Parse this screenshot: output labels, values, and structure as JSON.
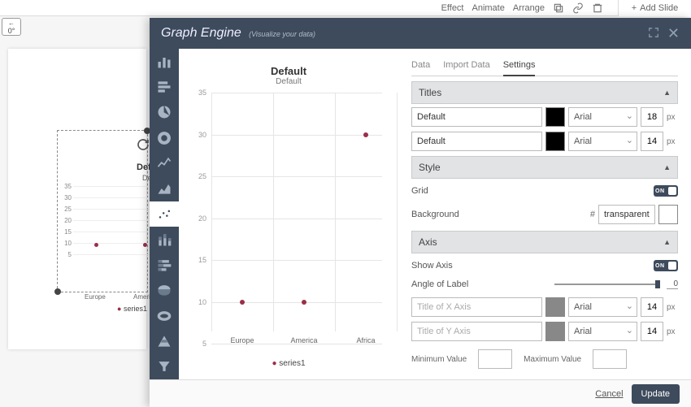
{
  "toolbar": {
    "effect": "Effect",
    "animate": "Animate",
    "arrange": "Arrange",
    "add_slide": "Add Slide",
    "zero": "0°"
  },
  "bg_chart": {
    "title": "Default",
    "subtitle": "Default",
    "legend": "series1",
    "xlabels": [
      "Europe",
      "America"
    ]
  },
  "modal": {
    "title": "Graph Engine",
    "subtitle": "(Visualize your data)"
  },
  "chart_data": {
    "type": "scatter",
    "title": "Default",
    "subtitle": "Default",
    "categories": [
      "Europe",
      "America",
      "Africa"
    ],
    "series": [
      {
        "name": "series1",
        "values": [
          10,
          10,
          30
        ]
      }
    ],
    "yticks": [
      5,
      10,
      15,
      20,
      25,
      30,
      35
    ],
    "ylim": [
      5,
      35
    ]
  },
  "preview_legend": "series1",
  "tabs": {
    "data": "Data",
    "import": "Import Data",
    "settings": "Settings"
  },
  "sections": {
    "titles": "Titles",
    "style": "Style",
    "axis": "Axis"
  },
  "inputs": {
    "title1_value": "Default",
    "title1_font": "Arial",
    "title1_size": "18",
    "title2_value": "Default",
    "title2_font": "Arial",
    "title2_size": "14",
    "grid_label": "Grid",
    "grid_on": "ON",
    "bg_label": "Background",
    "bg_value": "transparent",
    "show_axis_label": "Show Axis",
    "show_axis_on": "ON",
    "angle_label": "Angle of Label",
    "angle_value": "0",
    "xaxis_placeholder": "Title of X Axis",
    "xaxis_font": "Arial",
    "xaxis_size": "14",
    "yaxis_placeholder": "Title of Y Axis",
    "yaxis_font": "Arial",
    "yaxis_size": "14",
    "min_label": "Minimum Value",
    "max_label": "Maximum Value",
    "px": "px",
    "hash": "#"
  },
  "footer": {
    "cancel": "Cancel",
    "update": "Update"
  }
}
